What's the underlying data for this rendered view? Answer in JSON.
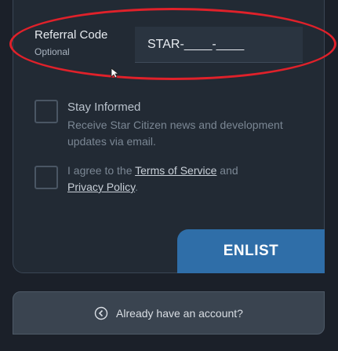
{
  "referral": {
    "label": "Referral Code",
    "sublabel": "Optional",
    "value": "STAR-____-____"
  },
  "stay_informed": {
    "title": "Stay Informed",
    "description": "Receive Star Citizen news and development updates via email."
  },
  "agreement": {
    "prefix": "I agree to the ",
    "terms_link": "Terms of Service",
    "middle": " and ",
    "privacy_link": "Privacy Policy",
    "suffix": "."
  },
  "enlist_label": "ENLIST",
  "account_link": "Already have an account?",
  "icons": {
    "back": "circle-arrow-left-icon",
    "cursor": "mouse-cursor-icon"
  },
  "colors": {
    "accent": "#2f6ea8",
    "highlight": "#e0212a"
  }
}
